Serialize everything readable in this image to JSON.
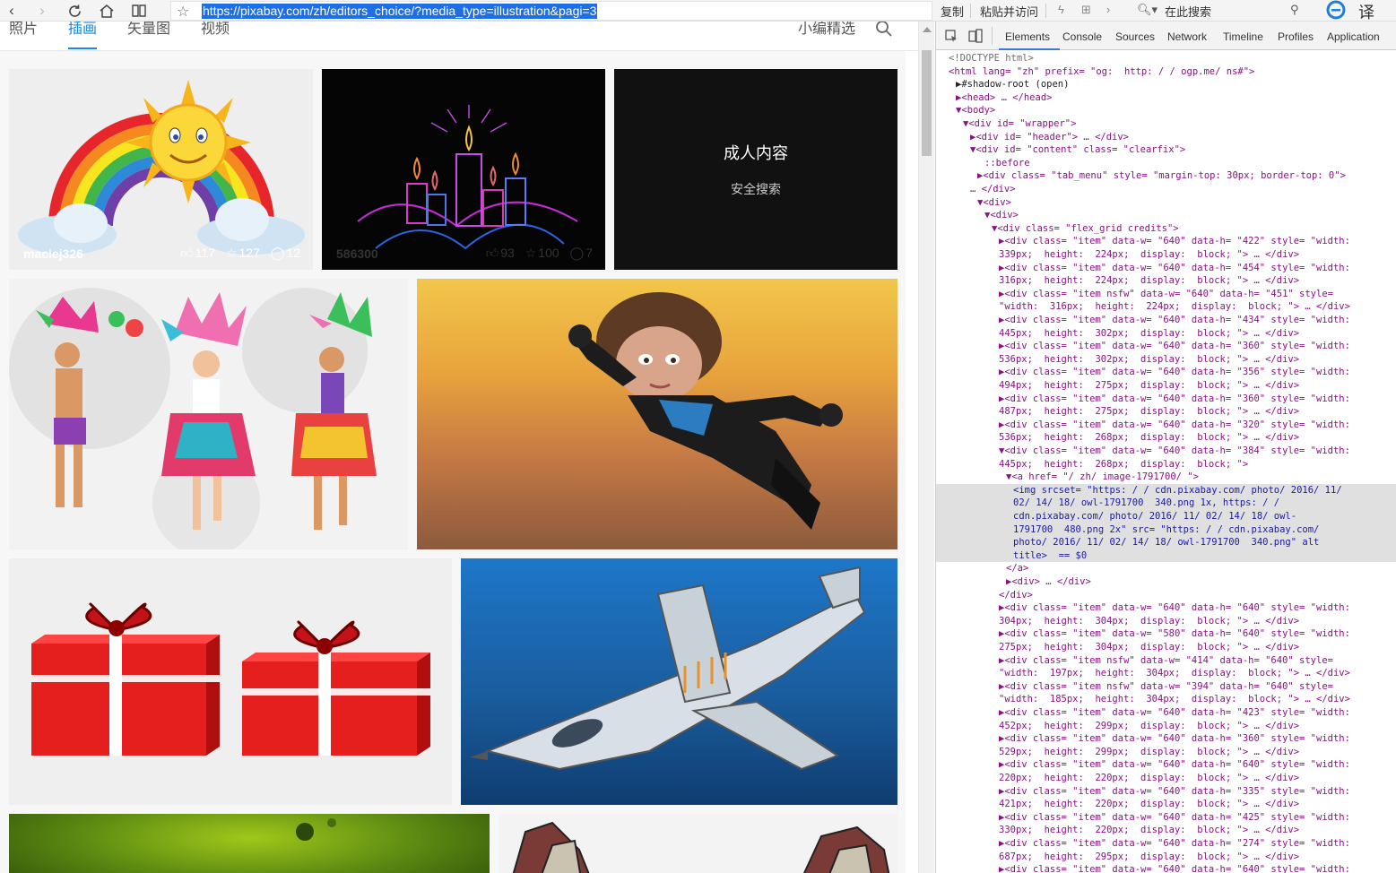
{
  "browser": {
    "url": "https://pixabay.com/zh/editors_choice/?media_type=illustration&pagi=3",
    "copy_label": "复制",
    "paste_visit_label": "粘贴并访问",
    "search_placeholder": "在此搜索",
    "translate_label": "译"
  },
  "page_tabs": {
    "photos": "照片",
    "illustrations": "插画",
    "vectors": "矢量图",
    "videos": "视频",
    "editors_choice": "小编精选"
  },
  "tiles": [
    {
      "id": "rainbow-sun",
      "author": "maciej326",
      "likes": "117",
      "favorites": "127",
      "comments": "12"
    },
    {
      "id": "candles-neon",
      "author": "586300",
      "likes": "93",
      "favorites": "100",
      "comments": "7"
    },
    {
      "id": "nsfw",
      "title": "成人内容",
      "subtitle": "安全搜索"
    },
    {
      "id": "carnival-dancers"
    },
    {
      "id": "flying-hero"
    },
    {
      "id": "gift-boxes"
    },
    {
      "id": "fighter-jet"
    },
    {
      "id": "green-virus"
    },
    {
      "id": "feathers"
    }
  ],
  "devtools": {
    "tabs": [
      "Elements",
      "Console",
      "Sources",
      "Network",
      "Timeline",
      "Profiles",
      "Application"
    ],
    "active_tab": "Elements",
    "lines": [
      {
        "i": 0,
        "t": "<!DOCTYPE html>",
        "c": "cm"
      },
      {
        "i": 0,
        "t": "<html lang= \"zh\" prefix= \"og:  http: / / ogp.me/ ns#\">",
        "c": "tg"
      },
      {
        "i": 1,
        "t": "▶#shadow-root (open)",
        "c": "n"
      },
      {
        "i": 1,
        "t": "▶<head> … </head>",
        "c": "tg"
      },
      {
        "i": 1,
        "t": "▼<body>",
        "c": "tg"
      },
      {
        "i": 2,
        "t": "▼<div id= \"wrapper\">",
        "c": "tg"
      },
      {
        "i": 3,
        "t": "▶<div id= \"header\"> … </div>",
        "c": "tg"
      },
      {
        "i": 3,
        "t": "▼<div id= \"content\" class= \"clearfix\">",
        "c": "tg"
      },
      {
        "i": 5,
        "t": "::before",
        "c": "tg"
      },
      {
        "i": 4,
        "t": "▶<div class= \"tab_menu\" style= \"margin-top: 30px; border-top: 0\">",
        "c": "tg"
      },
      {
        "i": 3,
        "t": "… </div>",
        "c": "tg"
      },
      {
        "i": 4,
        "t": "▼<div>",
        "c": "tg"
      },
      {
        "i": 5,
        "t": "▼<div>",
        "c": "tg"
      },
      {
        "i": 6,
        "t": "▼<div class= \"flex_grid credits\">",
        "c": "tg"
      },
      {
        "i": 7,
        "t": "▶<div class= \"item\" data-w= \"640\" data-h= \"422\" style= \"width:",
        "c": "tg"
      },
      {
        "i": 7,
        "t": "339px;  height:  224px;  display:  block; \"> … </div>",
        "c": "tg"
      },
      {
        "i": 7,
        "t": "▶<div class= \"item\" data-w= \"640\" data-h= \"454\" style= \"width:",
        "c": "tg"
      },
      {
        "i": 7,
        "t": "316px;  height:  224px;  display:  block; \"> … </div>",
        "c": "tg"
      },
      {
        "i": 7,
        "t": "▶<div class= \"item nsfw\" data-w= \"640\" data-h= \"451\" style=",
        "c": "tg"
      },
      {
        "i": 7,
        "t": "\"width:  316px;  height:  224px;  display:  block; \"> … </div>",
        "c": "tg"
      },
      {
        "i": 7,
        "t": "▶<div class= \"item\" data-w= \"640\" data-h= \"434\" style= \"width:",
        "c": "tg"
      },
      {
        "i": 7,
        "t": "445px;  height:  302px;  display:  block; \"> … </div>",
        "c": "tg"
      },
      {
        "i": 7,
        "t": "▶<div class= \"item\" data-w= \"640\" data-h= \"360\" style= \"width:",
        "c": "tg"
      },
      {
        "i": 7,
        "t": "536px;  height:  302px;  display:  block; \"> … </div>",
        "c": "tg"
      },
      {
        "i": 7,
        "t": "▶<div class= \"item\" data-w= \"640\" data-h= \"356\" style= \"width:",
        "c": "tg"
      },
      {
        "i": 7,
        "t": "494px;  height:  275px;  display:  block; \"> … </div>",
        "c": "tg"
      },
      {
        "i": 7,
        "t": "▶<div class= \"item\" data-w= \"640\" data-h= \"360\" style= \"width:",
        "c": "tg"
      },
      {
        "i": 7,
        "t": "487px;  height:  275px;  display:  block; \"> … </div>",
        "c": "tg"
      },
      {
        "i": 7,
        "t": "▶<div class= \"item\" data-w= \"640\" data-h= \"320\" style= \"width:",
        "c": "tg"
      },
      {
        "i": 7,
        "t": "536px;  height:  268px;  display:  block; \"> … </div>",
        "c": "tg"
      },
      {
        "i": 7,
        "t": "▼<div class= \"item\" data-w= \"640\" data-h= \"384\" style= \"width:",
        "c": "tg"
      },
      {
        "i": 7,
        "t": "445px;  height:  268px;  display:  block; \">",
        "c": "tg"
      },
      {
        "i": 8,
        "t": "▼<a href= \"/ zh/ image-1791700/ \">",
        "c": "tg"
      },
      {
        "i": 9,
        "t": "<img srcset= \"https: / / cdn.pixabay.com/ photo/ 2016/ 11/",
        "c": "sel"
      },
      {
        "i": 9,
        "t": "02/ 14/ 18/ owl-1791700  340.png 1x, https: / /",
        "c": "sel"
      },
      {
        "i": 9,
        "t": "cdn.pixabay.com/ photo/ 2016/ 11/ 02/ 14/ 18/ owl-",
        "c": "sel"
      },
      {
        "i": 9,
        "t": "1791700  480.png 2x\" src= \"https: / / cdn.pixabay.com/",
        "c": "sel"
      },
      {
        "i": 9,
        "t": "photo/ 2016/ 11/ 02/ 14/ 18/ owl-1791700  340.png\" alt",
        "c": "sel"
      },
      {
        "i": 9,
        "t": "title>  == $0",
        "c": "sel"
      },
      {
        "i": 8,
        "t": "</a>",
        "c": "tg"
      },
      {
        "i": 8,
        "t": "▶<div> … </div>",
        "c": "tg"
      },
      {
        "i": 7,
        "t": "</div>",
        "c": "tg"
      },
      {
        "i": 7,
        "t": "▶<div class= \"item\" data-w= \"640\" data-h= \"640\" style= \"width:",
        "c": "tg"
      },
      {
        "i": 7,
        "t": "304px;  height:  304px;  display:  block; \"> … </div>",
        "c": "tg"
      },
      {
        "i": 7,
        "t": "▶<div class= \"item\" data-w= \"580\" data-h= \"640\" style= \"width:",
        "c": "tg"
      },
      {
        "i": 7,
        "t": "275px;  height:  304px;  display:  block; \"> … </div>",
        "c": "tg"
      },
      {
        "i": 7,
        "t": "▶<div class= \"item nsfw\" data-w= \"414\" data-h= \"640\" style=",
        "c": "tg"
      },
      {
        "i": 7,
        "t": "\"width:  197px;  height:  304px;  display:  block; \"> … </div>",
        "c": "tg"
      },
      {
        "i": 7,
        "t": "▶<div class= \"item nsfw\" data-w= \"394\" data-h= \"640\" style=",
        "c": "tg"
      },
      {
        "i": 7,
        "t": "\"width:  185px;  height:  304px;  display:  block; \"> … </div>",
        "c": "tg"
      },
      {
        "i": 7,
        "t": "▶<div class= \"item\" data-w= \"640\" data-h= \"423\" style= \"width:",
        "c": "tg"
      },
      {
        "i": 7,
        "t": "452px;  height:  299px;  display:  block; \"> … </div>",
        "c": "tg"
      },
      {
        "i": 7,
        "t": "▶<div class= \"item\" data-w= \"640\" data-h= \"360\" style= \"width:",
        "c": "tg"
      },
      {
        "i": 7,
        "t": "529px;  height:  299px;  display:  block; \"> … </div>",
        "c": "tg"
      },
      {
        "i": 7,
        "t": "▶<div class= \"item\" data-w= \"640\" data-h= \"640\" style= \"width:",
        "c": "tg"
      },
      {
        "i": 7,
        "t": "220px;  height:  220px;  display:  block; \"> … </div>",
        "c": "tg"
      },
      {
        "i": 7,
        "t": "▶<div class= \"item\" data-w= \"640\" data-h= \"335\" style= \"width:",
        "c": "tg"
      },
      {
        "i": 7,
        "t": "421px;  height:  220px;  display:  block; \"> … </div>",
        "c": "tg"
      },
      {
        "i": 7,
        "t": "▶<div class= \"item\" data-w= \"640\" data-h= \"425\" style= \"width:",
        "c": "tg"
      },
      {
        "i": 7,
        "t": "330px;  height:  220px;  display:  block; \"> … </div>",
        "c": "tg"
      },
      {
        "i": 7,
        "t": "▶<div class= \"item\" data-w= \"640\" data-h= \"274\" style= \"width:",
        "c": "tg"
      },
      {
        "i": 7,
        "t": "687px;  height:  295px;  display:  block; \"> … </div>",
        "c": "tg"
      },
      {
        "i": 7,
        "t": "▶<div class= \"item\" data-w= \"640\" data-h= \"640\" style= \"width:",
        "c": "tg"
      }
    ]
  }
}
